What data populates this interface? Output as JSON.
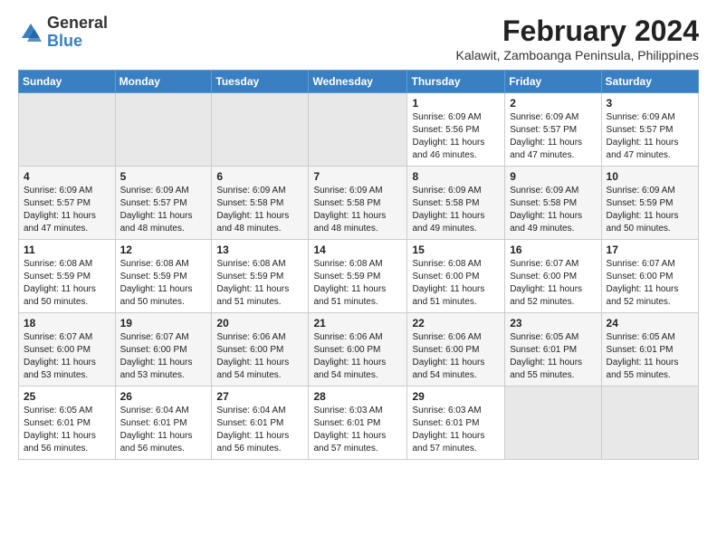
{
  "header": {
    "logo": {
      "line1": "General",
      "line2": "Blue"
    },
    "month_year": "February 2024",
    "subtitle": "Kalawit, Zamboanga Peninsula, Philippines"
  },
  "days_of_week": [
    "Sunday",
    "Monday",
    "Tuesday",
    "Wednesday",
    "Thursday",
    "Friday",
    "Saturday"
  ],
  "weeks": [
    [
      {
        "day": "",
        "info": ""
      },
      {
        "day": "",
        "info": ""
      },
      {
        "day": "",
        "info": ""
      },
      {
        "day": "",
        "info": ""
      },
      {
        "day": "1",
        "info": "Sunrise: 6:09 AM\nSunset: 5:56 PM\nDaylight: 11 hours\nand 46 minutes."
      },
      {
        "day": "2",
        "info": "Sunrise: 6:09 AM\nSunset: 5:57 PM\nDaylight: 11 hours\nand 47 minutes."
      },
      {
        "day": "3",
        "info": "Sunrise: 6:09 AM\nSunset: 5:57 PM\nDaylight: 11 hours\nand 47 minutes."
      }
    ],
    [
      {
        "day": "4",
        "info": "Sunrise: 6:09 AM\nSunset: 5:57 PM\nDaylight: 11 hours\nand 47 minutes."
      },
      {
        "day": "5",
        "info": "Sunrise: 6:09 AM\nSunset: 5:57 PM\nDaylight: 11 hours\nand 48 minutes."
      },
      {
        "day": "6",
        "info": "Sunrise: 6:09 AM\nSunset: 5:58 PM\nDaylight: 11 hours\nand 48 minutes."
      },
      {
        "day": "7",
        "info": "Sunrise: 6:09 AM\nSunset: 5:58 PM\nDaylight: 11 hours\nand 48 minutes."
      },
      {
        "day": "8",
        "info": "Sunrise: 6:09 AM\nSunset: 5:58 PM\nDaylight: 11 hours\nand 49 minutes."
      },
      {
        "day": "9",
        "info": "Sunrise: 6:09 AM\nSunset: 5:58 PM\nDaylight: 11 hours\nand 49 minutes."
      },
      {
        "day": "10",
        "info": "Sunrise: 6:09 AM\nSunset: 5:59 PM\nDaylight: 11 hours\nand 50 minutes."
      }
    ],
    [
      {
        "day": "11",
        "info": "Sunrise: 6:08 AM\nSunset: 5:59 PM\nDaylight: 11 hours\nand 50 minutes."
      },
      {
        "day": "12",
        "info": "Sunrise: 6:08 AM\nSunset: 5:59 PM\nDaylight: 11 hours\nand 50 minutes."
      },
      {
        "day": "13",
        "info": "Sunrise: 6:08 AM\nSunset: 5:59 PM\nDaylight: 11 hours\nand 51 minutes."
      },
      {
        "day": "14",
        "info": "Sunrise: 6:08 AM\nSunset: 5:59 PM\nDaylight: 11 hours\nand 51 minutes."
      },
      {
        "day": "15",
        "info": "Sunrise: 6:08 AM\nSunset: 6:00 PM\nDaylight: 11 hours\nand 51 minutes."
      },
      {
        "day": "16",
        "info": "Sunrise: 6:07 AM\nSunset: 6:00 PM\nDaylight: 11 hours\nand 52 minutes."
      },
      {
        "day": "17",
        "info": "Sunrise: 6:07 AM\nSunset: 6:00 PM\nDaylight: 11 hours\nand 52 minutes."
      }
    ],
    [
      {
        "day": "18",
        "info": "Sunrise: 6:07 AM\nSunset: 6:00 PM\nDaylight: 11 hours\nand 53 minutes."
      },
      {
        "day": "19",
        "info": "Sunrise: 6:07 AM\nSunset: 6:00 PM\nDaylight: 11 hours\nand 53 minutes."
      },
      {
        "day": "20",
        "info": "Sunrise: 6:06 AM\nSunset: 6:00 PM\nDaylight: 11 hours\nand 54 minutes."
      },
      {
        "day": "21",
        "info": "Sunrise: 6:06 AM\nSunset: 6:00 PM\nDaylight: 11 hours\nand 54 minutes."
      },
      {
        "day": "22",
        "info": "Sunrise: 6:06 AM\nSunset: 6:00 PM\nDaylight: 11 hours\nand 54 minutes."
      },
      {
        "day": "23",
        "info": "Sunrise: 6:05 AM\nSunset: 6:01 PM\nDaylight: 11 hours\nand 55 minutes."
      },
      {
        "day": "24",
        "info": "Sunrise: 6:05 AM\nSunset: 6:01 PM\nDaylight: 11 hours\nand 55 minutes."
      }
    ],
    [
      {
        "day": "25",
        "info": "Sunrise: 6:05 AM\nSunset: 6:01 PM\nDaylight: 11 hours\nand 56 minutes."
      },
      {
        "day": "26",
        "info": "Sunrise: 6:04 AM\nSunset: 6:01 PM\nDaylight: 11 hours\nand 56 minutes."
      },
      {
        "day": "27",
        "info": "Sunrise: 6:04 AM\nSunset: 6:01 PM\nDaylight: 11 hours\nand 56 minutes."
      },
      {
        "day": "28",
        "info": "Sunrise: 6:03 AM\nSunset: 6:01 PM\nDaylight: 11 hours\nand 57 minutes."
      },
      {
        "day": "29",
        "info": "Sunrise: 6:03 AM\nSunset: 6:01 PM\nDaylight: 11 hours\nand 57 minutes."
      },
      {
        "day": "",
        "info": ""
      },
      {
        "day": "",
        "info": ""
      }
    ]
  ]
}
